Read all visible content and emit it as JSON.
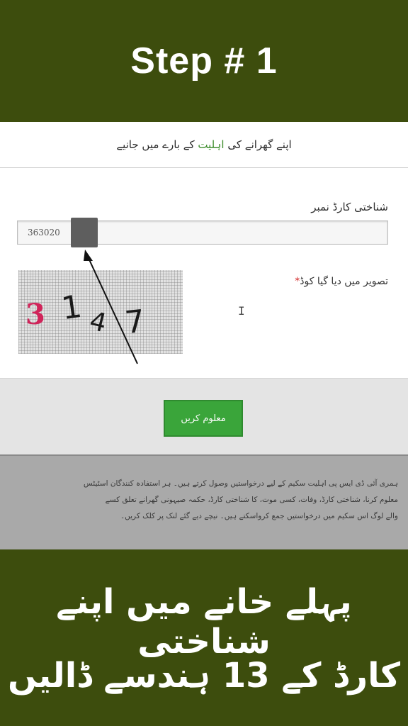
{
  "banner": {
    "title": "Step # 1"
  },
  "page": {
    "heading_pre": "اپنے گھرانے کی ",
    "heading_highlight": "اہلیت",
    "heading_post": " کے بارے میں جانیے"
  },
  "form": {
    "cnic_label": "شناختی کارڈ نمبر",
    "cnic_value": "363020",
    "captcha_label": "تصویر میں دیا گیا کوڈ",
    "required_mark": "*",
    "captcha_digits": [
      "3",
      "1",
      "4",
      "7"
    ],
    "cursor_glyph": "I"
  },
  "button": {
    "submit_label": "معلوم کریں"
  },
  "info": {
    "line1": "ہمری آئی ڈی ایس پی اہلیت سکیم کے لیے درخواستیں وصول کرتے ہیں۔ ہر استفادہ کنندگان اسٹیٹس",
    "line2": "معلوم کرنا، شناختی کارڈ، وفات، کسی موت، کا شناختی کارڈ، حکمہ صیہونی گھرانے تعلق کسے",
    "line3": "والے لوگ اس سکیم میں درخواستیں جمع کرواسکتے ہیں۔ نیچے دیے گئے لنک پر کلک کریں۔"
  },
  "instructions": {
    "line1": "پہلے خانے میں اپنے شناختی",
    "line2": "کارڈ کے 13 ہندسے ڈالیں"
  },
  "colors": {
    "banner_bg": "#3d4d0d",
    "button_bg": "#3aa53a",
    "highlight": "#3b8c2a",
    "required": "#d22b2b"
  }
}
